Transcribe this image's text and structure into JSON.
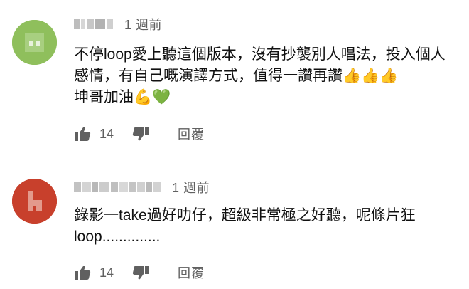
{
  "comments": [
    {
      "author_name": "",
      "time": "1 週前",
      "avatar_color": "#8fbf5c",
      "text": "不停loop愛上聽這個版本，沒有抄襲別人唱法，投入個人感情，有自己嘅演譯方式，值得一讚再讚👍👍👍\n坤哥加油💪💚",
      "likes": "14",
      "reply_label": "回覆",
      "like_icon": "thumbs-up-icon",
      "dislike_icon": "thumbs-down-icon"
    },
    {
      "author_name": "",
      "time": "1 週前",
      "avatar_color": "#c8402c",
      "text": "錄影一take過好叻仔，超級非常極之好聽，呢條片狂loop..............",
      "likes": "14",
      "reply_label": "回覆",
      "like_icon": "thumbs-up-icon",
      "dislike_icon": "thumbs-down-icon"
    }
  ]
}
